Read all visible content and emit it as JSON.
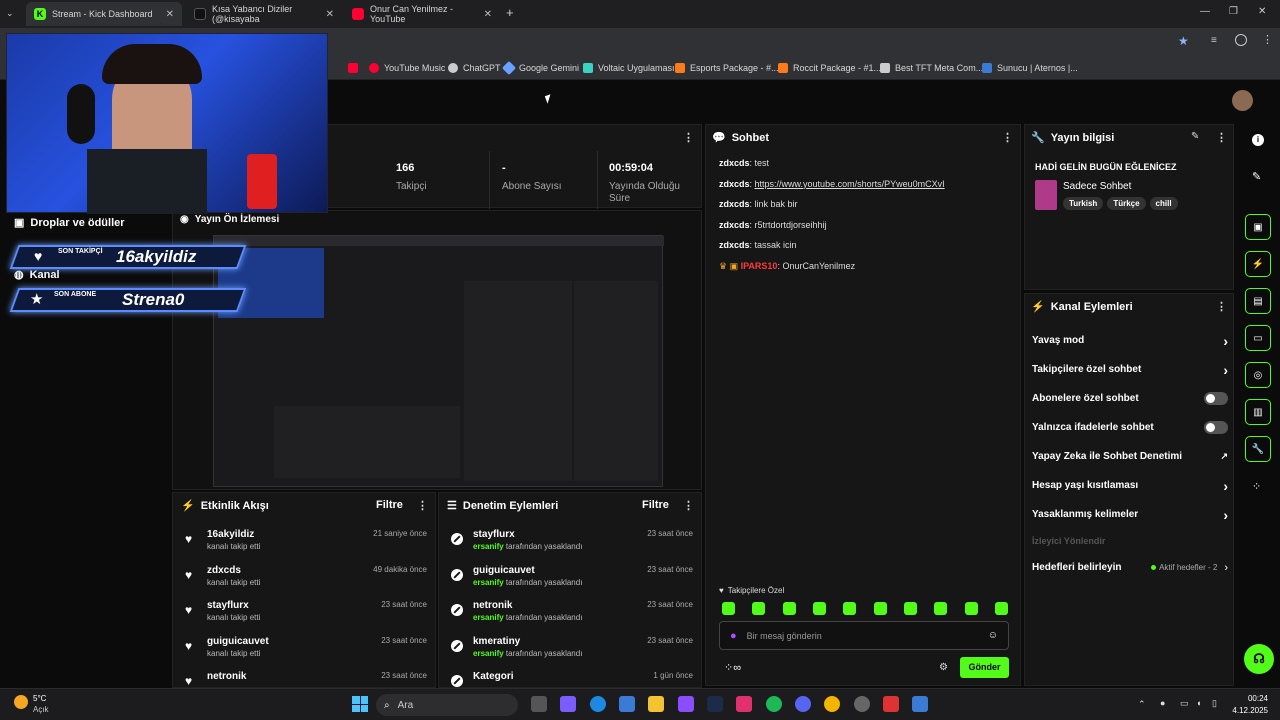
{
  "tabs": [
    {
      "label": "Stream - Kick Dashboard",
      "color": "#53fc18"
    },
    {
      "label": "Kısa Yabancı Diziler (@kisayaba",
      "color": "#111111"
    },
    {
      "label": "Onur Can Yenilmez - YouTube",
      "color": "#ff0033"
    }
  ],
  "bookmarks": [
    {
      "label": "YouTube Music",
      "color": "#ff0033"
    },
    {
      "label": "ChatGPT",
      "color": "#cccccc"
    },
    {
      "label": "Google Gemini",
      "color": "#6aa0ff"
    },
    {
      "label": "Voltaic Uygulaması",
      "color": "#3ad3c0"
    },
    {
      "label": "Esports Package - #...",
      "color": "#ff7a1a"
    },
    {
      "label": "Roccit Package - #1...",
      "color": "#ff7a1a"
    },
    {
      "label": "Best TFT Meta Com...",
      "color": "#cccccc"
    },
    {
      "label": "Sunucu | Aternos |...",
      "color": "#3a7bd5"
    }
  ],
  "stats": {
    "viewers_value": "166",
    "viewers_label": "Takipçi",
    "subs_value": "-",
    "subs_label": "Abone Sayısı",
    "uptime_value": "00:59:04",
    "uptime_label": "Yayında Olduğu Süre"
  },
  "left_panels": {
    "drops": "Droplar ve ödüller",
    "channel": "Kanal",
    "preview": "Yayın Ön İzlemesi"
  },
  "overlay": {
    "follower_tag": "SON TAKİPÇİ",
    "follower_name": "16akyildiz",
    "sub_tag": "SON ABONE",
    "sub_name": "Strena0"
  },
  "chat": {
    "title": "Sohbet",
    "messages": [
      {
        "user": "zdxcds",
        "text": "test"
      },
      {
        "user": "zdxcds",
        "text": "https://www.youtube.com/shorts/PYweu0mCXvI"
      },
      {
        "user": "zdxcds",
        "text": "link bak bir"
      },
      {
        "user": "zdxcds",
        "text": "r5trtdortdjorseihhij"
      },
      {
        "user": "zdxcds",
        "text": "tassak icin"
      },
      {
        "user": "IPARS10",
        "text": "OnurCanYenilmez"
      }
    ],
    "followers_only": "Takipçilere Özel",
    "placeholder": "Bir mesaj gönderin",
    "send": "Gönder"
  },
  "activity": {
    "title": "Etkinlik Akışı",
    "filter": "Filtre",
    "items": [
      {
        "name": "16akyildiz",
        "sub": "kanalı takip etti",
        "time": "21 saniye önce"
      },
      {
        "name": "zdxcds",
        "sub": "kanalı takip etti",
        "time": "49 dakika önce"
      },
      {
        "name": "stayflurx",
        "sub": "kanalı takip etti",
        "time": "23 saat önce"
      },
      {
        "name": "guiguicauvet",
        "sub": "kanalı takip etti",
        "time": "23 saat önce"
      },
      {
        "name": "netronik",
        "sub": "",
        "time": "23 saat önce"
      }
    ]
  },
  "moderation": {
    "title": "Denetim Eylemleri",
    "filter": "Filtre",
    "items": [
      {
        "name": "stayflurx",
        "mod": "ersanify",
        "sub": "tarafından yasaklandı",
        "time": "23 saat önce"
      },
      {
        "name": "guiguicauvet",
        "mod": "ersanify",
        "sub": "tarafından yasaklandı",
        "time": "23 saat önce"
      },
      {
        "name": "netronik",
        "mod": "ersanify",
        "sub": "tarafından yasaklandı",
        "time": "23 saat önce"
      },
      {
        "name": "kmeratiny",
        "mod": "ersanify",
        "sub": "tarafından yasaklandı",
        "time": "23 saat önce"
      },
      {
        "name": "Kategori",
        "mod": "",
        "sub": "",
        "time": "1 gün önce"
      }
    ]
  },
  "stream_info": {
    "title": "Yayın bilgisi",
    "stream_title": "HADİ GELİN BUGÜN EĞLENİCEZ",
    "category": "Sadece Sohbet",
    "tags": [
      "Turkish",
      "Türkçe",
      "chill"
    ]
  },
  "channel_actions": {
    "title": "Kanal Eylemleri",
    "items": [
      {
        "label": "Yavaş mod",
        "kind": "arrow"
      },
      {
        "label": "Takipçilere özel sohbet",
        "kind": "arrow"
      },
      {
        "label": "Abonelere özel sohbet",
        "kind": "toggle"
      },
      {
        "label": "Yalnızca ifadelerle sohbet",
        "kind": "toggle"
      },
      {
        "label": "Yapay Zeka ile Sohbet Denetimi",
        "kind": "external"
      },
      {
        "label": "Hesap yaşı kısıtlaması",
        "kind": "arrow"
      },
      {
        "label": "Yasaklanmış kelimeler",
        "kind": "arrow"
      }
    ],
    "section": "İzleyici Yönlendir",
    "goals": "Hedefleri belirleyin",
    "goals_status": "Aktif hedefler - 2"
  },
  "taskbar": {
    "weather_temp": "5°C",
    "weather_desc": "Açık",
    "search": "Ara",
    "time": "00:24",
    "date": "4.12.2025"
  },
  "colors": {
    "accent": "#53fc18",
    "bg": "#0b0b0c",
    "panel": "#161617"
  }
}
